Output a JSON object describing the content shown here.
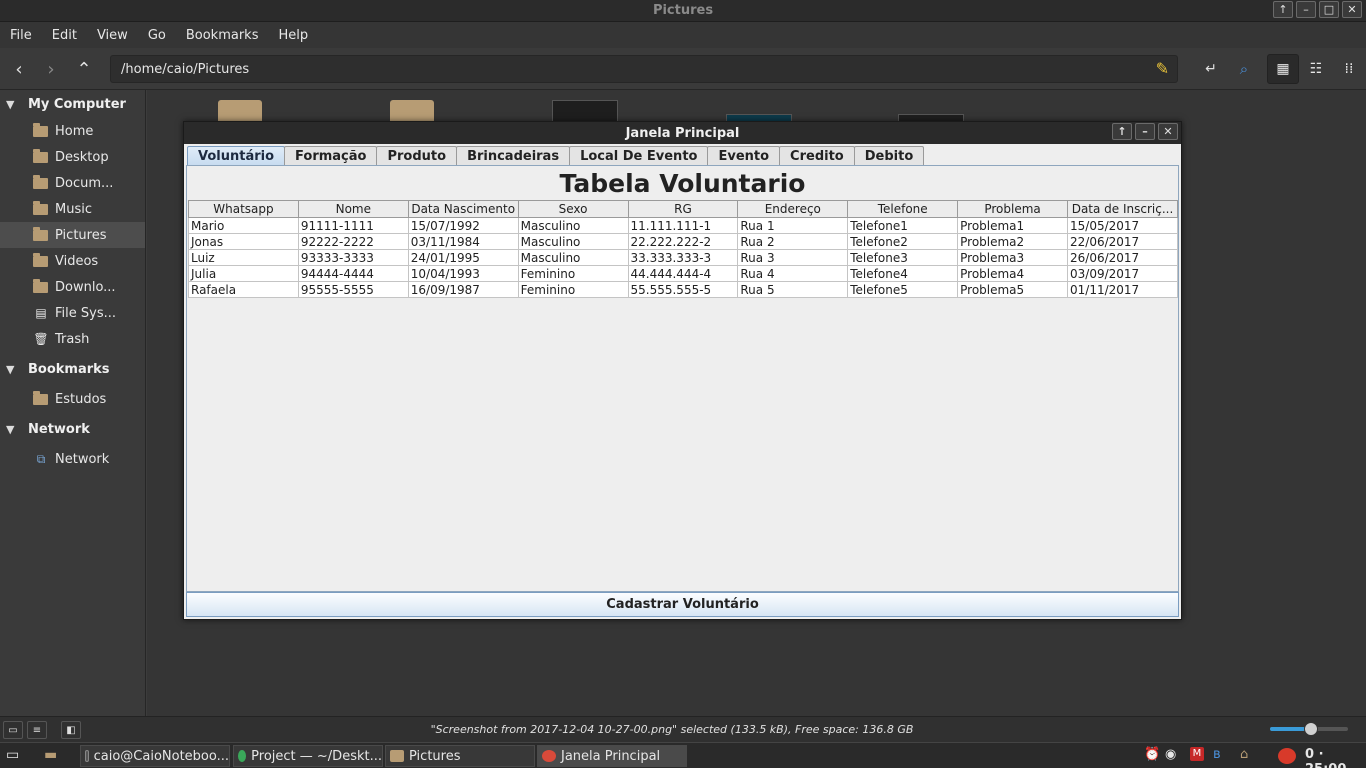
{
  "window": {
    "title": "Pictures",
    "controls": [
      "↑",
      "–",
      "□",
      "✕"
    ]
  },
  "menubar": [
    "File",
    "Edit",
    "View",
    "Go",
    "Bookmarks",
    "Help"
  ],
  "toolbar": {
    "path": "/home/caio/Pictures"
  },
  "sidebar": {
    "sections": [
      {
        "label": "My Computer",
        "items": [
          "Home",
          "Desktop",
          "Docum...",
          "Music",
          "Pictures",
          "Videos",
          "Downlo...",
          "File Sys...",
          "Trash"
        ]
      },
      {
        "label": "Bookmarks",
        "items": [
          "Estudos"
        ]
      },
      {
        "label": "Network",
        "items": [
          "Network"
        ]
      }
    ],
    "selected": "Pictures"
  },
  "status": {
    "text": "\"Screenshot from 2017-12-04 10-27-00.png\" selected (133.5 kB), Free space: 136.8 GB",
    "zoom_fraction": 0.45
  },
  "taskbar": {
    "tasks": [
      "caio@CaioNoteboo...",
      "Project — ~/Deskt...",
      "Pictures",
      "Janela Principal"
    ],
    "clock": "0 · 25:00"
  },
  "dialog": {
    "title": "Janela Principal",
    "tabs": [
      "Voluntário",
      "Formação",
      "Produto",
      "Brincadeiras",
      "Local De Evento",
      "Evento",
      "Credito",
      "Debito"
    ],
    "active_tab": "Voluntário",
    "table_title": "Tabela Voluntario",
    "columns": [
      "Whatsapp",
      "Nome",
      "Data Nascimento",
      "Sexo",
      "RG",
      "Endereço",
      "Telefone",
      "Problema",
      "Data de Inscriç..."
    ],
    "rows": [
      [
        "Mario",
        "91111-1111",
        "15/07/1992",
        "Masculino",
        "11.111.111-1",
        "Rua 1",
        "Telefone1",
        "Problema1",
        "15/05/2017"
      ],
      [
        "Jonas",
        "92222-2222",
        "03/11/1984",
        "Masculino",
        "22.222.222-2",
        "Rua 2",
        "Telefone2",
        "Problema2",
        "22/06/2017"
      ],
      [
        "Luiz",
        "93333-3333",
        "24/01/1995",
        "Masculino",
        "33.333.333-3",
        "Rua 3",
        "Telefone3",
        "Problema3",
        "26/06/2017"
      ],
      [
        "Julia",
        "94444-4444",
        "10/04/1993",
        "Feminino",
        "44.444.444-4",
        "Rua 4",
        "Telefone4",
        "Problema4",
        "03/09/2017"
      ],
      [
        "Rafaela",
        "95555-5555",
        "16/09/1987",
        "Feminino",
        "55.555.555-5",
        "Rua 5",
        "Telefone5",
        "Problema5",
        "01/11/2017"
      ]
    ],
    "register_button": "Cadastrar Voluntário"
  },
  "colors": {
    "accent": "#3a9bd8",
    "folder": "#b79c74",
    "tab_active": "#c8dcf0"
  }
}
